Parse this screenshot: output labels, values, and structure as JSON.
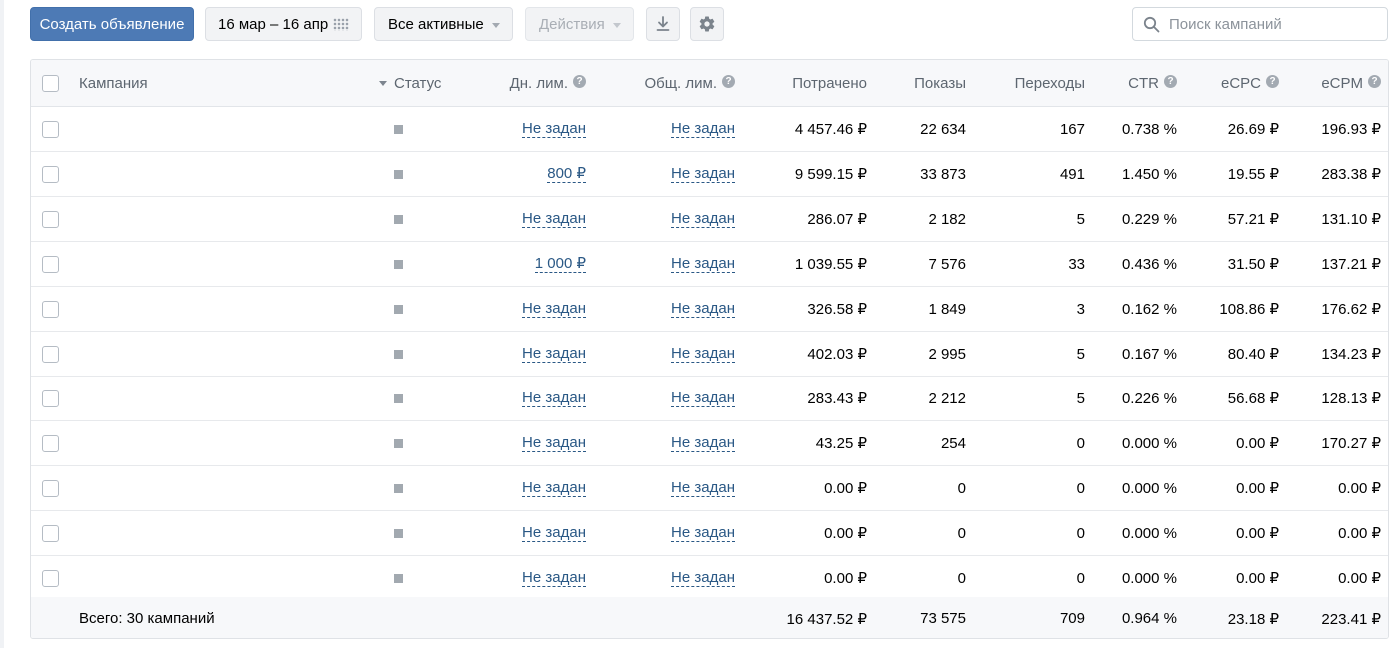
{
  "toolbar": {
    "create_label": "Создать объявление",
    "date_range": "16 мар – 16 апр",
    "filter_label": "Все активные",
    "actions_label": "Действия",
    "search_placeholder": "Поиск кампаний"
  },
  "table": {
    "headers": {
      "campaign": "Кампания",
      "status": "Статус",
      "day_limit": "Дн. лим.",
      "total_limit": "Общ. лим.",
      "spent": "Потрачено",
      "shows": "Показы",
      "clicks": "Переходы",
      "ctr": "CTR",
      "ecpc": "eCPC",
      "ecpm": "eCPM"
    },
    "help_glyph": "?",
    "rows": [
      {
        "name": "",
        "day_limit": "Не задан",
        "total_limit": "Не задан",
        "spent": "4 457.46 ₽",
        "shows": "22 634",
        "clicks": "167",
        "ctr": "0.738 %",
        "ecpc": "26.69 ₽",
        "ecpm": "196.93 ₽"
      },
      {
        "name": "",
        "day_limit": "800 ₽",
        "total_limit": "Не задан",
        "spent": "9 599.15 ₽",
        "shows": "33 873",
        "clicks": "491",
        "ctr": "1.450 %",
        "ecpc": "19.55 ₽",
        "ecpm": "283.38 ₽"
      },
      {
        "name": "",
        "day_limit": "Не задан",
        "total_limit": "Не задан",
        "spent": "286.07 ₽",
        "shows": "2 182",
        "clicks": "5",
        "ctr": "0.229 %",
        "ecpc": "57.21 ₽",
        "ecpm": "131.10 ₽"
      },
      {
        "name": "",
        "day_limit": "1 000 ₽",
        "total_limit": "Не задан",
        "spent": "1 039.55 ₽",
        "shows": "7 576",
        "clicks": "33",
        "ctr": "0.436 %",
        "ecpc": "31.50 ₽",
        "ecpm": "137.21 ₽"
      },
      {
        "name": "",
        "day_limit": "Не задан",
        "total_limit": "Не задан",
        "spent": "326.58 ₽",
        "shows": "1 849",
        "clicks": "3",
        "ctr": "0.162 %",
        "ecpc": "108.86 ₽",
        "ecpm": "176.62 ₽"
      },
      {
        "name": "",
        "day_limit": "Не задан",
        "total_limit": "Не задан",
        "spent": "402.03 ₽",
        "shows": "2 995",
        "clicks": "5",
        "ctr": "0.167 %",
        "ecpc": "80.40 ₽",
        "ecpm": "134.23 ₽"
      },
      {
        "name": "",
        "day_limit": "Не задан",
        "total_limit": "Не задан",
        "spent": "283.43 ₽",
        "shows": "2 212",
        "clicks": "5",
        "ctr": "0.226 %",
        "ecpc": "56.68 ₽",
        "ecpm": "128.13 ₽"
      },
      {
        "name": "",
        "day_limit": "Не задан",
        "total_limit": "Не задан",
        "spent": "43.25 ₽",
        "shows": "254",
        "clicks": "0",
        "ctr": "0.000 %",
        "ecpc": "0.00 ₽",
        "ecpm": "170.27 ₽"
      },
      {
        "name": "",
        "day_limit": "Не задан",
        "total_limit": "Не задан",
        "spent": "0.00 ₽",
        "shows": "0",
        "clicks": "0",
        "ctr": "0.000 %",
        "ecpc": "0.00 ₽",
        "ecpm": "0.00 ₽"
      },
      {
        "name": "",
        "day_limit": "Не задан",
        "total_limit": "Не задан",
        "spent": "0.00 ₽",
        "shows": "0",
        "clicks": "0",
        "ctr": "0.000 %",
        "ecpc": "0.00 ₽",
        "ecpm": "0.00 ₽"
      },
      {
        "name": "",
        "day_limit": "Не задан",
        "total_limit": "Не задан",
        "spent": "0.00 ₽",
        "shows": "0",
        "clicks": "0",
        "ctr": "0.000 %",
        "ecpc": "0.00 ₽",
        "ecpm": "0.00 ₽"
      }
    ],
    "footer": {
      "label": "Всего: 30 кампаний",
      "spent": "16 437.52 ₽",
      "shows": "73 575",
      "clicks": "709",
      "ctr": "0.964 %",
      "ecpc": "23.18 ₽",
      "ecpm": "223.41 ₽"
    }
  },
  "colors": {
    "primary": "#4d7ab5",
    "link": "#2a5885",
    "status_square": "#a2a9b0"
  }
}
